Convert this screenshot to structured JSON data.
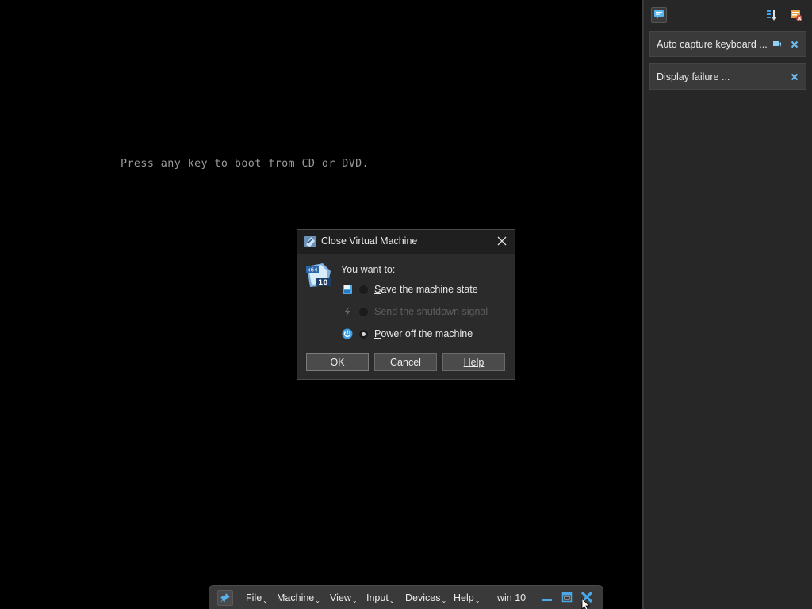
{
  "vm_screen": {
    "boot_message": "Press any key to boot from CD or DVD."
  },
  "notification_center": {
    "items": [
      {
        "text": "Auto capture keyboard ..."
      },
      {
        "text": "Display failure ..."
      }
    ]
  },
  "dialog": {
    "title": "Close Virtual Machine",
    "os_badge": {
      "arch": "x64",
      "version": "10"
    },
    "prompt": "You want to:",
    "options": [
      {
        "label_mnemonic": "S",
        "label_rest": "ave the machine state",
        "enabled": true,
        "checked": false
      },
      {
        "label_mnemonic": "",
        "label_rest": "Send the shutdown signal",
        "enabled": false,
        "checked": false
      },
      {
        "label_mnemonic": "P",
        "label_rest": "ower off the machine",
        "enabled": true,
        "checked": true
      }
    ],
    "buttons": {
      "ok": "OK",
      "cancel": "Cancel",
      "help": "Help"
    }
  },
  "toolbar": {
    "menus": [
      "File",
      "Machine",
      "View",
      "Input",
      "Devices",
      "Help"
    ],
    "vm_name": "win 10"
  },
  "colors": {
    "accent": "#3ea0e8",
    "panel": "#272727",
    "dialog_bg": "#2b2b2b"
  }
}
